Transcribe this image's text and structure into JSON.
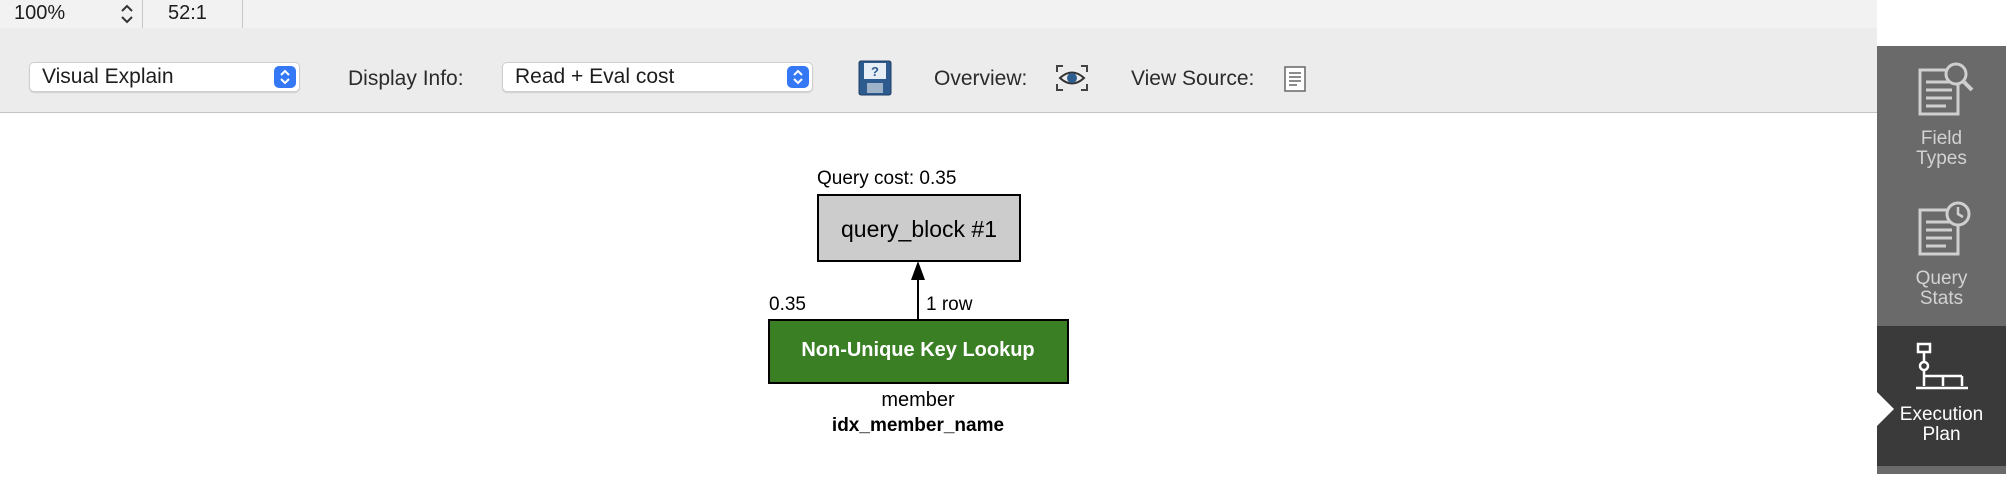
{
  "status": {
    "zoom": "100%",
    "cursor_position": "52:1"
  },
  "toolbar": {
    "view_mode": "Visual Explain",
    "display_info_label": "Display Info:",
    "display_info_value": "Read + Eval cost",
    "overview_label": "Overview:",
    "view_source_label": "View Source:",
    "icons": [
      "save-plan-icon",
      "overview-eye-icon",
      "view-source-icon"
    ]
  },
  "plan": {
    "query_cost": "Query cost: 0.35",
    "query_block": "query_block #1",
    "row_count": "1 row",
    "node_cost": "0.35",
    "node_label": "Non-Unique Key Lookup",
    "table_name": "member",
    "index_name": "idx_member_name",
    "colors": {
      "query_block_fill": "#cccccc",
      "lookup_fill": "#3b7f25"
    }
  },
  "sidebar": {
    "items": [
      {
        "label": "Field\nTypes",
        "icon": "field-types-icon",
        "active": false
      },
      {
        "label": "Query\nStats",
        "icon": "query-stats-icon",
        "active": false
      },
      {
        "label": "Execution\nPlan",
        "icon": "execution-plan-icon",
        "active": true
      }
    ]
  },
  "colors": {
    "accent": "#3478f6",
    "sidebar_bg": "#6a6a6a",
    "sidebar_active_bg": "#3a3a3a"
  }
}
